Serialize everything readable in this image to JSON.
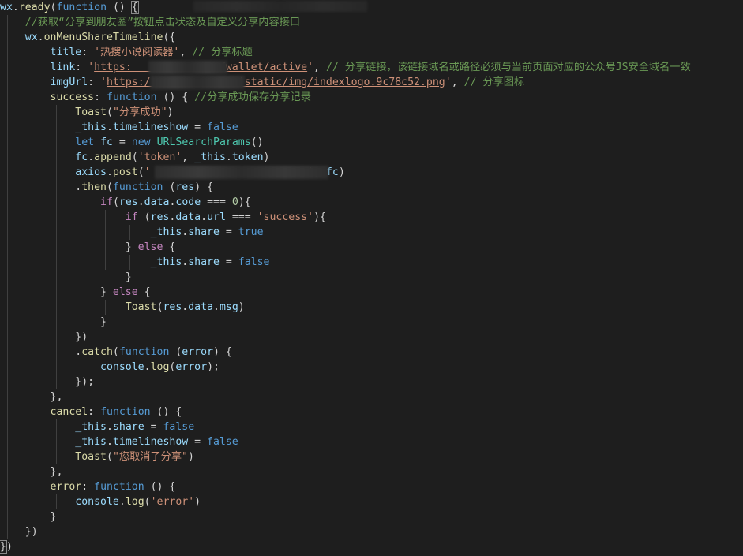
{
  "editor": {
    "lines": [
      "wx.ready(function () {",
      "    //获取“分享到朋友圈”按钮点击状态及自定义分享内容接口",
      "    wx.onMenuShareTimeline({",
      "        title: '热搜小说阅读器', // 分享标题",
      "        link: 'https:              /wallet/active', // 分享链接，该链接域名或路径必须与当前页面对应的公众号JS安全域名一致",
      "        imgUrl: 'https:/              'static/img/indexlogo.9c78c52.png', // 分享图标",
      "        success: function () { //分享成功保存分享记录",
      "            Toast(\"分享成功\")",
      "            _this.timelineshow = false",
      "            let fc = new URLSearchParams()",
      "            fc.append('token', _this.token)",
      "            axios.post('                         ', fc)",
      "            .then(function (res) {",
      "                if(res.data.code === 0){",
      "                    if (res.data.url === 'success'){",
      "                        _this.share = true",
      "                    } else {",
      "                        _this.share = false",
      "                    }",
      "                } else {",
      "                    Toast(res.data.msg)",
      "                }",
      "            })",
      "            .catch(function (error) {",
      "                console.log(error);",
      "            });",
      "        },",
      "        cancel: function () {",
      "            _this.share = false",
      "            _this.timelineshow = false",
      "            Toast(\"您取消了分享\")",
      "        },",
      "        error: function () {",
      "            console.log('error')",
      "        }",
      "    })",
      "})"
    ]
  }
}
